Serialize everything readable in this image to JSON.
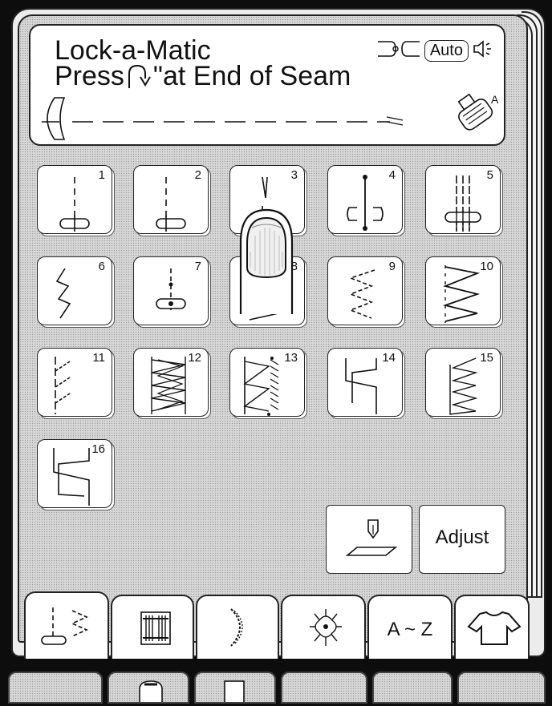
{
  "screen": {
    "title_line1": "Lock-a-Matic",
    "title_line2_before": "Press",
    "title_line2_after": " \"at End of Seam",
    "auto_label": "Auto",
    "foot_letter": "A"
  },
  "stitches": [
    {
      "num": "1",
      "icon": "straight-stitch-center-icon"
    },
    {
      "num": "2",
      "icon": "straight-stitch-left-icon"
    },
    {
      "num": "3",
      "icon": "straight-stitch-reinforced-icon"
    },
    {
      "num": "4",
      "icon": "basting-stitch-icon"
    },
    {
      "num": "5",
      "icon": "triple-straight-stitch-icon"
    },
    {
      "num": "6",
      "icon": "stretch-zigzag-icon"
    },
    {
      "num": "7",
      "icon": "tacking-stitch-icon"
    },
    {
      "num": "8",
      "icon": "zigzag-stitch-icon"
    },
    {
      "num": "9",
      "icon": "three-step-zigzag-icon"
    },
    {
      "num": "10",
      "icon": "wide-zigzag-icon"
    },
    {
      "num": "11",
      "icon": "blind-hem-icon"
    },
    {
      "num": "12",
      "icon": "double-overlock-icon"
    },
    {
      "num": "13",
      "icon": "overcasting-icon"
    },
    {
      "num": "14",
      "icon": "blanket-stitch-icon"
    },
    {
      "num": "15",
      "icon": "multi-zigzag-icon"
    },
    {
      "num": "16",
      "icon": "shell-tuck-icon"
    }
  ],
  "buttons": {
    "adjust_label": "Adjust"
  },
  "tabs": [
    {
      "name": "utility-stitches",
      "label": ""
    },
    {
      "name": "buttonholes",
      "label": ""
    },
    {
      "name": "satin-stitches",
      "label": ""
    },
    {
      "name": "decorative-stitches",
      "label": ""
    },
    {
      "name": "alphabet",
      "label": "A ~ Z"
    },
    {
      "name": "applications",
      "label": ""
    }
  ],
  "colors": {
    "background": "#0d0d0d",
    "panel": "#d6d6d6",
    "tile": "#ffffff",
    "ink": "#111111"
  }
}
